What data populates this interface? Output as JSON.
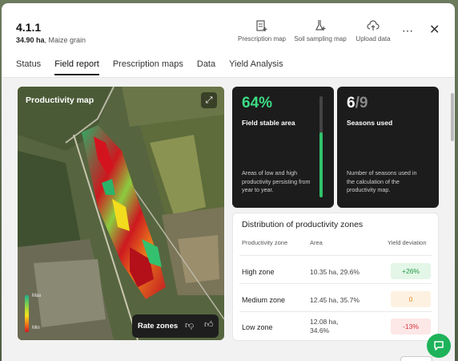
{
  "header": {
    "title": "4.1.1",
    "area": "34.90 ha",
    "crop": ", Maize grain",
    "actions": [
      {
        "label": "Prescription map",
        "icon": "prescription-map-icon"
      },
      {
        "label": "Soil sampling map",
        "icon": "soil-sampling-icon"
      },
      {
        "label": "Upload data",
        "icon": "upload-icon"
      }
    ],
    "more_label": "⋯",
    "close_label": "✕"
  },
  "tabs": [
    {
      "label": "Status",
      "active": false
    },
    {
      "label": "Field report",
      "active": true
    },
    {
      "label": "Prescription maps",
      "active": false
    },
    {
      "label": "Data",
      "active": false
    },
    {
      "label": "Yield Analysis",
      "active": false
    }
  ],
  "map": {
    "title": "Productivity map",
    "legend_max": "Max",
    "legend_min": "Min",
    "rate_label": "Rate zones",
    "expand_icon": "expand-icon"
  },
  "stable_card": {
    "value": "64%",
    "fill_fraction": 0.64,
    "label": "Field stable area",
    "desc": "Areas of low and high productivity persisting from year to year."
  },
  "seasons_card": {
    "used": "6",
    "total": "/9",
    "label": "Seasons used",
    "desc": "Number of seasons used in the calculation of the productivity map."
  },
  "distribution": {
    "title": "Distribution of productivity zones",
    "headers": [
      "Productivity zone",
      "Area",
      "Yield deviation"
    ],
    "rows": [
      {
        "zone": "High zone",
        "area": "10.35 ha, 29.6%",
        "deviation": "+26%",
        "tone": "green"
      },
      {
        "zone": "Medium zone",
        "area": "12.45 ha, 35.7%",
        "deviation": "0",
        "tone": "orange"
      },
      {
        "zone": "Low zone",
        "area": "12.08 ha, 34.6%",
        "deviation": "-13%",
        "tone": "red"
      }
    ]
  },
  "colors": {
    "accent_green": "#3ddc84",
    "chat_green": "#1eb35a"
  }
}
